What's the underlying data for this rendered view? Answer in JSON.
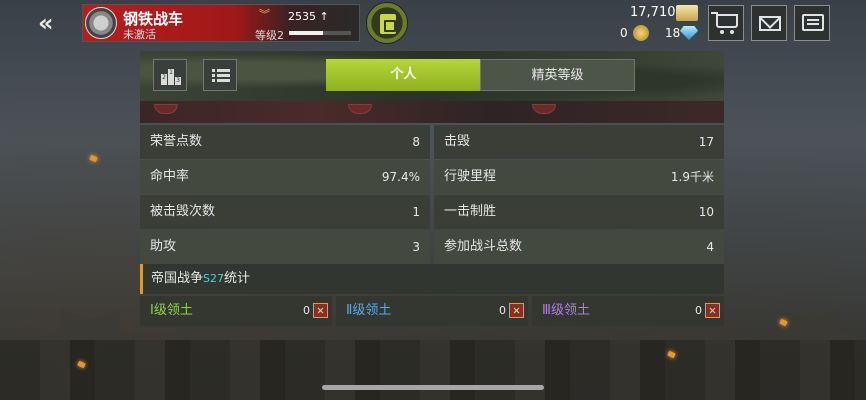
{
  "header": {
    "back_glyph": "«",
    "profile": {
      "name": "钢铁战车",
      "status": "未激活",
      "points": "2535",
      "points_arrow": "↑",
      "level": "等级2",
      "level_progress": 0.55
    },
    "currency": {
      "gold": "17,710",
      "coins": "0",
      "gems": "18"
    }
  },
  "panel": {
    "tabs": [
      {
        "label": "个人",
        "active": true
      },
      {
        "label": "精英等级",
        "active": false
      }
    ],
    "stats": [
      {
        "left_label": "荣誉点数",
        "left_value": "8",
        "right_label": "击毁",
        "right_value": "17"
      },
      {
        "left_label": "命中率",
        "left_value": "97.4%",
        "right_label": "行驶里程",
        "right_value": "1.9千米"
      },
      {
        "left_label": "被击毁次数",
        "left_value": "1",
        "right_label": "一击制胜",
        "right_value": "10"
      },
      {
        "left_label": "助攻",
        "left_value": "3",
        "right_label": "参加战斗总数",
        "right_value": "4"
      }
    ],
    "empire": {
      "prefix": "帝国战争",
      "season": "S27",
      "suffix": "统计"
    },
    "territories": [
      {
        "label": "Ⅰ级领土",
        "count": "0"
      },
      {
        "label": "Ⅱ级领土",
        "count": "0"
      },
      {
        "label": "Ⅲ级领土",
        "count": "0"
      }
    ]
  },
  "colors": {
    "accent_green": "#9dc42c",
    "profile_red": "#b81d1d",
    "empire_bar": "#d99a32",
    "territory_1": "#8fd14f",
    "territory_2": "#5aa6ee",
    "territory_3": "#b57ae6"
  }
}
